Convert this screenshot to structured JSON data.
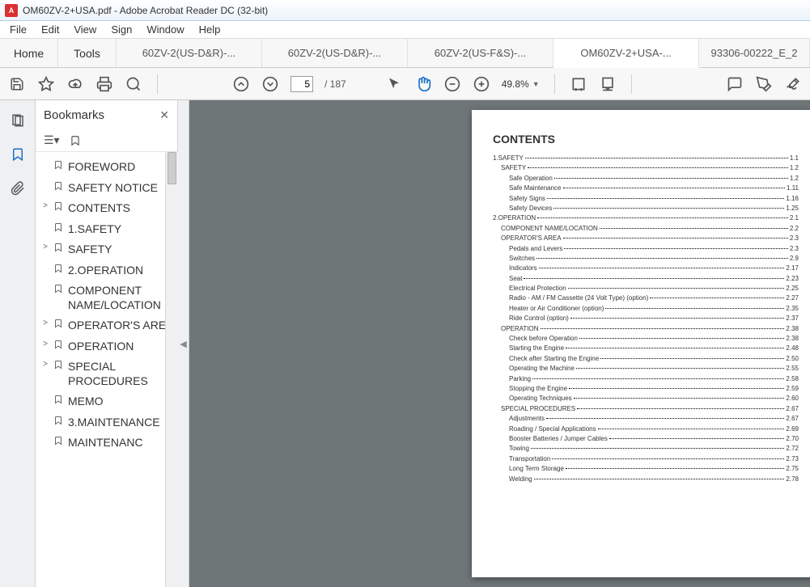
{
  "window": {
    "title": "OM60ZV-2+USA.pdf - Adobe Acrobat Reader DC (32-bit)"
  },
  "menu": [
    "File",
    "Edit",
    "View",
    "Sign",
    "Window",
    "Help"
  ],
  "tabs": {
    "home": "Home",
    "tools": "Tools",
    "docs": [
      "60ZV-2(US-D&R)-...",
      "60ZV-2(US-D&R)-...",
      "60ZV-2(US-F&S)-...",
      "OM60ZV-2+USA-...",
      "93306-00222_E_2"
    ],
    "active": 3
  },
  "toolbar": {
    "page_current": "5",
    "page_total": "/  187",
    "zoom": "49.8%"
  },
  "bookmarks": {
    "title": "Bookmarks",
    "items": [
      {
        "exp": "",
        "label": "FOREWORD"
      },
      {
        "exp": "",
        "label": "SAFETY NOTICE"
      },
      {
        "exp": ">",
        "label": "CONTENTS"
      },
      {
        "exp": "",
        "label": "1.SAFETY"
      },
      {
        "exp": ">",
        "label": "SAFETY"
      },
      {
        "exp": "",
        "label": "2.OPERATION"
      },
      {
        "exp": "",
        "label": "COMPONENT NAME/LOCATION"
      },
      {
        "exp": ">",
        "label": "OPERATOR'S AREA"
      },
      {
        "exp": ">",
        "label": "OPERATION"
      },
      {
        "exp": ">",
        "label": "SPECIAL PROCEDURES"
      },
      {
        "exp": "",
        "label": "MEMO"
      },
      {
        "exp": "",
        "label": "3.MAINTENANCE"
      },
      {
        "exp": "",
        "label": "MAINTENANC"
      }
    ]
  },
  "page": {
    "heading": "CONTENTS",
    "toc": [
      {
        "l": 0,
        "t": "1.SAFETY",
        "p": "1.1"
      },
      {
        "l": 1,
        "t": "SAFETY",
        "p": "1.2"
      },
      {
        "l": 2,
        "t": "Safe Operation",
        "p": "1.2"
      },
      {
        "l": 2,
        "t": "Safe Maintenance",
        "p": "1.11"
      },
      {
        "l": 2,
        "t": "Safety Signs",
        "p": "1.16"
      },
      {
        "l": 2,
        "t": "Safety Devices",
        "p": "1.25"
      },
      {
        "l": 0,
        "t": "2.OPERATION",
        "p": "2.1"
      },
      {
        "l": 1,
        "t": "COMPONENT NAME/LOCATION",
        "p": "2.2"
      },
      {
        "l": 1,
        "t": "OPERATOR'S AREA",
        "p": "2.3"
      },
      {
        "l": 2,
        "t": "Pedals and Levers",
        "p": "2.3"
      },
      {
        "l": 2,
        "t": "Switches",
        "p": "2.9"
      },
      {
        "l": 2,
        "t": "Indicators",
        "p": "2.17"
      },
      {
        "l": 2,
        "t": "Seat",
        "p": "2.23"
      },
      {
        "l": 2,
        "t": "Electrical Protection",
        "p": "2.25"
      },
      {
        "l": 2,
        "t": "Radio - AM / FM Cassette  (24 Volt Type) (option)",
        "p": "2.27"
      },
      {
        "l": 2,
        "t": "Heater or Air Conditioner (option)",
        "p": "2.35"
      },
      {
        "l": 2,
        "t": "Ride Control (option)",
        "p": "2.37"
      },
      {
        "l": 1,
        "t": "OPERATION",
        "p": "2.38"
      },
      {
        "l": 2,
        "t": "Check before Operation",
        "p": "2.38"
      },
      {
        "l": 2,
        "t": "Starting the Engine",
        "p": "2.48"
      },
      {
        "l": 2,
        "t": "Check after Starting the Engine",
        "p": "2.50"
      },
      {
        "l": 2,
        "t": "Operating the Machine",
        "p": "2.55"
      },
      {
        "l": 2,
        "t": "Parking",
        "p": "2.58"
      },
      {
        "l": 2,
        "t": "Stopping the Engine",
        "p": "2.59"
      },
      {
        "l": 2,
        "t": "Operating Techniques",
        "p": "2.60"
      },
      {
        "l": 1,
        "t": "SPECIAL PROCEDURES",
        "p": "2.67"
      },
      {
        "l": 2,
        "t": "Adjustments",
        "p": "2.67"
      },
      {
        "l": 2,
        "t": "Roading / Special Applications",
        "p": "2.69"
      },
      {
        "l": 2,
        "t": "Booster Batteries / Jumper Cables",
        "p": "2.70"
      },
      {
        "l": 2,
        "t": "Towing",
        "p": "2.72"
      },
      {
        "l": 2,
        "t": "Transportation",
        "p": "2.73"
      },
      {
        "l": 2,
        "t": "Long Term Storage",
        "p": "2.75"
      },
      {
        "l": 2,
        "t": "Welding",
        "p": "2.78"
      }
    ]
  }
}
